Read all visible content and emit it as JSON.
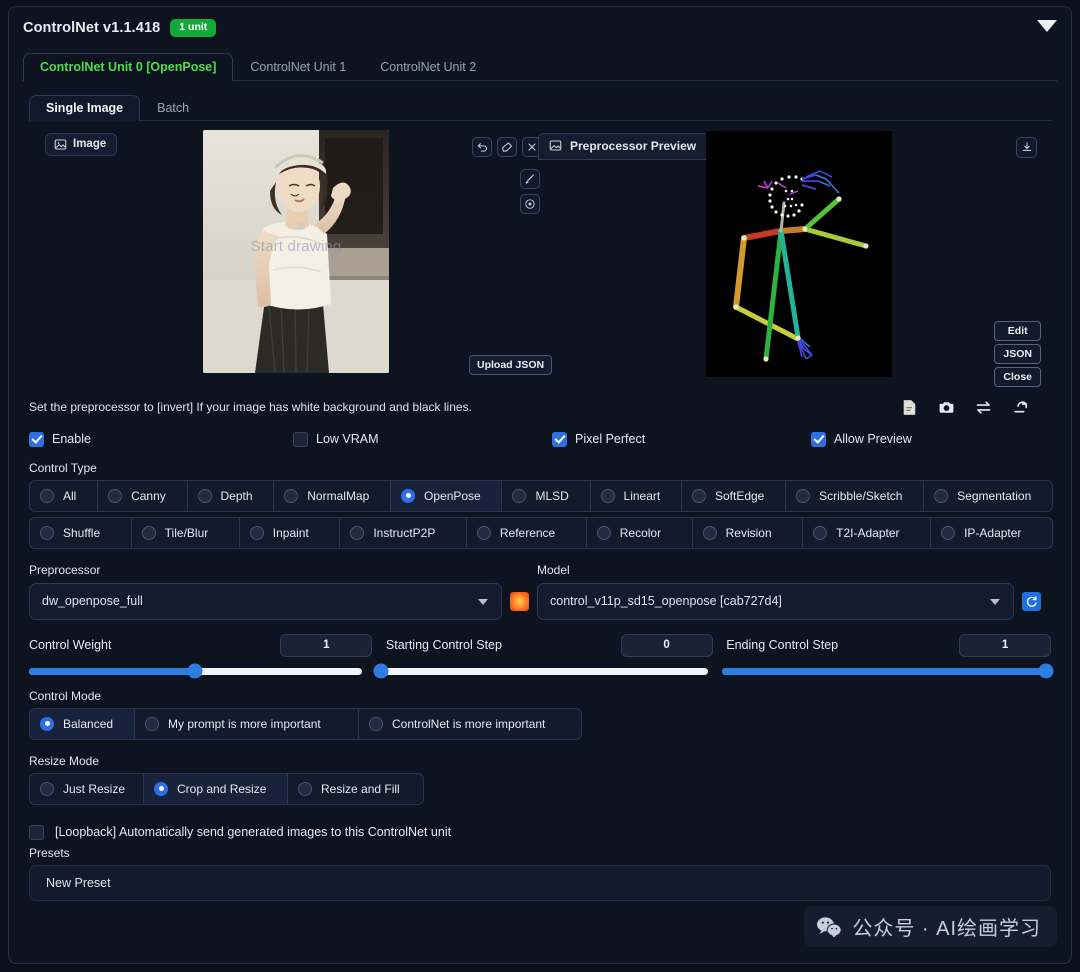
{
  "header": {
    "title": "ControlNet v1.1.418",
    "badge": "1 unit",
    "collapse_icon": "chevron-down-icon"
  },
  "unit_tabs": [
    {
      "label": "ControlNet Unit 0 [OpenPose]",
      "active": true
    },
    {
      "label": "ControlNet Unit 1",
      "active": false
    },
    {
      "label": "ControlNet Unit 2",
      "active": false
    }
  ],
  "sub_tabs": [
    {
      "label": "Single Image",
      "active": true
    },
    {
      "label": "Batch",
      "active": false
    }
  ],
  "media": {
    "image_chip_label": "Image",
    "image_chip_icon": "image-icon",
    "start_drawing_text": "Start drawing",
    "tool_buttons": [
      {
        "name": "undo-icon",
        "title": "Undo"
      },
      {
        "name": "eraser-icon",
        "title": "Erase"
      },
      {
        "name": "close-icon",
        "title": "Remove"
      },
      {
        "name": "brush-icon",
        "title": "Brush"
      },
      {
        "name": "color-palette-icon",
        "title": "Color"
      }
    ],
    "preprocessor_preview_label": "Preprocessor Preview",
    "preprocessor_preview_icon": "image-icon",
    "upload_json_label": "Upload JSON",
    "download_icon": "download-icon",
    "pose_buttons": [
      "Edit",
      "JSON",
      "Close"
    ]
  },
  "hint": {
    "text": "Set the preprocessor to [invert] If your image has white background and black lines.",
    "icons": [
      "document-edit-icon",
      "camera-icon",
      "swap-arrows-icon",
      "send-arrow-icon"
    ]
  },
  "checkboxes": [
    {
      "label": "Enable",
      "checked": true
    },
    {
      "label": "Low VRAM",
      "checked": false
    },
    {
      "label": "Pixel Perfect",
      "checked": true
    },
    {
      "label": "Allow Preview",
      "checked": true
    }
  ],
  "control_type": {
    "label": "Control Type",
    "selected": "OpenPose",
    "row1": [
      "All",
      "Canny",
      "Depth",
      "NormalMap",
      "OpenPose",
      "MLSD",
      "Lineart",
      "SoftEdge",
      "Scribble/Sketch",
      "Segmentation"
    ],
    "row2": [
      "Shuffle",
      "Tile/Blur",
      "Inpaint",
      "InstructP2P",
      "Reference",
      "Recolor",
      "Revision",
      "T2I-Adapter",
      "IP-Adapter"
    ]
  },
  "preprocessor": {
    "label": "Preprocessor",
    "value": "dw_openpose_full",
    "run_icon": "explosion-icon"
  },
  "model": {
    "label": "Model",
    "value": "control_v11p_sd15_openpose [cab727d4]",
    "refresh_icon": "refresh-icon"
  },
  "sliders": [
    {
      "name": "Control Weight",
      "value": "1",
      "pct": 50
    },
    {
      "name": "Starting Control Step",
      "value": "0",
      "pct": 0
    },
    {
      "name": "Ending Control Step",
      "value": "1",
      "pct": 100
    }
  ],
  "control_mode": {
    "label": "Control Mode",
    "selected": "Balanced",
    "options": [
      "Balanced",
      "My prompt is more important",
      "ControlNet is more important"
    ]
  },
  "resize_mode": {
    "label": "Resize Mode",
    "selected": "Crop and Resize",
    "options": [
      "Just Resize",
      "Crop and Resize",
      "Resize and Fill"
    ]
  },
  "loopback": {
    "label": "[Loopback] Automatically send generated images to this ControlNet unit",
    "checked": false
  },
  "presets": {
    "label": "Presets",
    "value": "New Preset"
  },
  "watermark": {
    "icon": "wechat-icon",
    "text": "公众号 · AI绘画学习"
  },
  "colors": {
    "accent_blue": "#2f7de0",
    "active_tab_green": "#4ade4a",
    "badge_green": "#12a93b",
    "panel_bg": "#0e1320",
    "page_bg": "#0b0f19"
  }
}
